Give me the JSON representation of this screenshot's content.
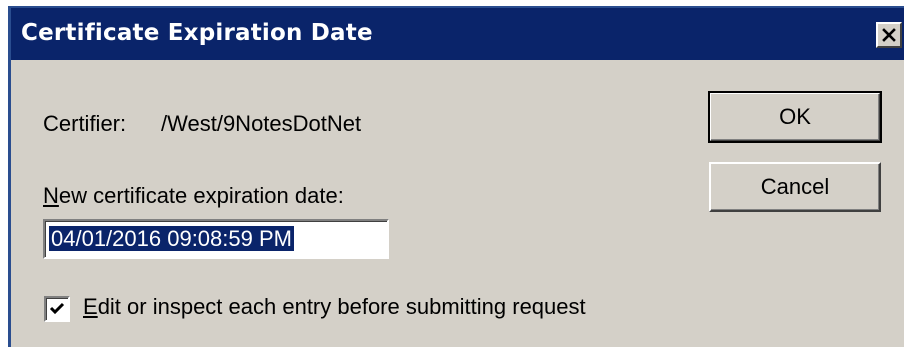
{
  "window": {
    "title": "Certificate Expiration Date"
  },
  "certifier": {
    "label": "Certifier:",
    "value": "/West/9NotesDotNet"
  },
  "expiration": {
    "label_mnemonic": "N",
    "label_rest": "ew certificate expiration date:",
    "value": "04/01/2016 09:08:59 PM"
  },
  "buttons": {
    "ok": "OK",
    "cancel": "Cancel"
  },
  "checkbox": {
    "checked": true,
    "label_mnemonic": "E",
    "label_rest": "dit or inspect each entry before submitting request"
  },
  "icons": {
    "close": "close-icon",
    "check": "checkmark-icon"
  },
  "colors": {
    "titlebar": "#0a246a",
    "dialog_face": "#d4d0c8",
    "selection": "#0a246a"
  }
}
